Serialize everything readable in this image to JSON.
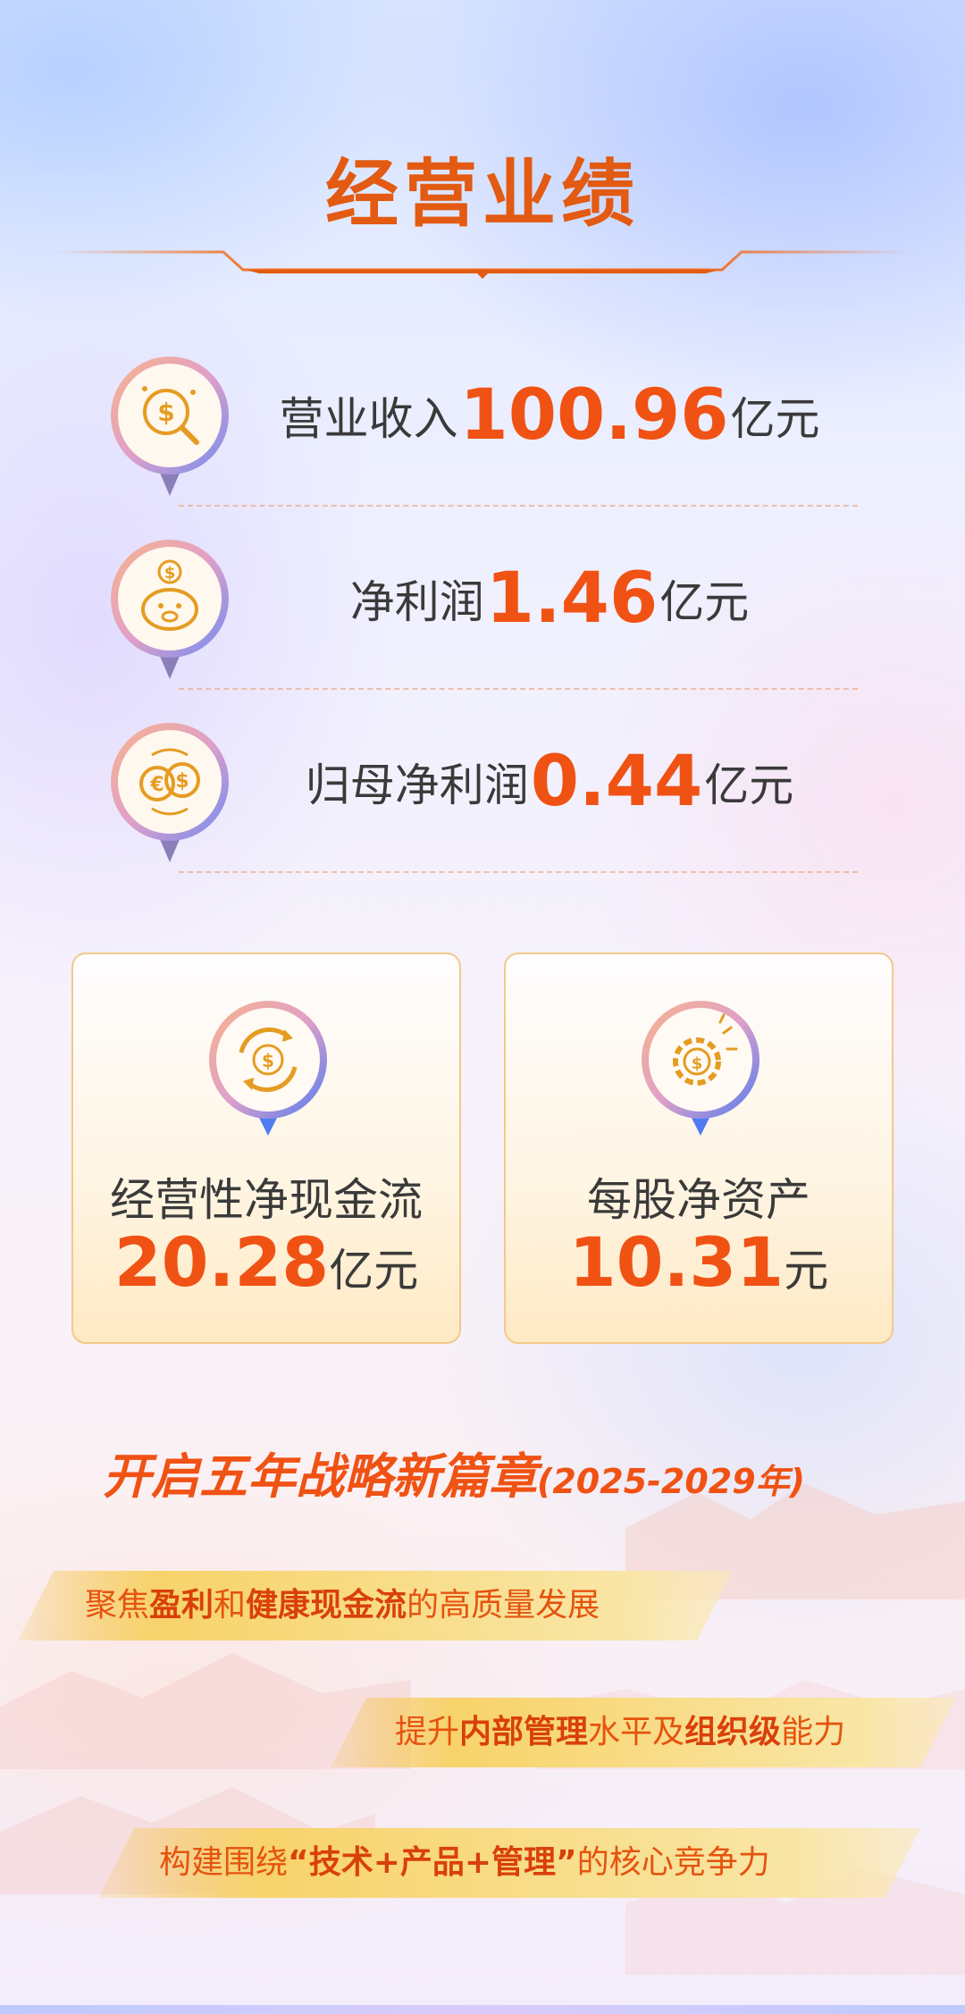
{
  "title": "经营业绩",
  "metrics": [
    {
      "name": "营业收入",
      "value": "100.96",
      "unit": "亿元",
      "icon": "money-search-icon"
    },
    {
      "name": "净利润",
      "value": "1.46",
      "unit": "亿元",
      "icon": "piggy-bank-icon"
    },
    {
      "name": "归母净利润",
      "value": "0.44",
      "unit": "亿元",
      "icon": "currency-exchange-icon"
    }
  ],
  "cards": [
    {
      "name": "经营性净现金流",
      "value": "20.28",
      "unit": "亿元",
      "icon": "cash-flow-icon"
    },
    {
      "name": "每股净资产",
      "value": "10.31",
      "unit": "元",
      "icon": "gear-dollar-icon"
    }
  ],
  "strategy": {
    "title": "开启五年战略新篇章",
    "years": "(2025-2029年)",
    "items": [
      {
        "p1": "聚焦",
        "b1": "盈利",
        "p2": "和",
        "b2": "健康现金流",
        "p3": "的高质量发展"
      },
      {
        "p1": "提升",
        "b1": "内部管理",
        "p2": "水平及",
        "b2": "组织级",
        "p3": "能力"
      },
      {
        "p1": "构建围绕",
        "q1": "“",
        "b1": "技术+产品+管理",
        "q2": "”",
        "p3": "的核心竞争力"
      }
    ]
  },
  "colors": {
    "accent": "#f05214",
    "title": "#e35a12",
    "text": "#3a3a3a",
    "gold": "#f3b73b"
  }
}
